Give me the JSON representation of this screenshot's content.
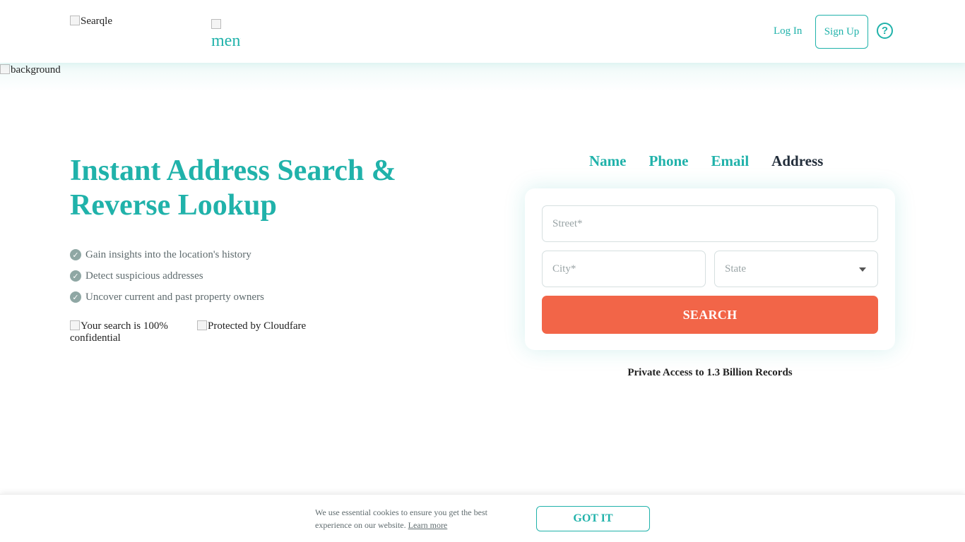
{
  "header": {
    "logo_alt": "Searqle",
    "menu_alt": "menu",
    "login_label": "Log In",
    "signup_label": "Sign Up",
    "help_symbol": "?",
    "accent_color": "#20b2aa"
  },
  "background_alt": "background",
  "hero": {
    "title_line1": "Instant Address Search &",
    "title_line2": "Reverse Lookup",
    "features": [
      "Gain insights into the location's history",
      "Detect suspicious addresses",
      "Uncover current and past property owners"
    ],
    "trust_badges": [
      "Your search is 100% confidential",
      "Protected by Cloudfare"
    ]
  },
  "search": {
    "tabs": [
      "Name",
      "Phone",
      "Email",
      "Address"
    ],
    "active_tab": "Address",
    "street_placeholder": "Street*",
    "city_placeholder": "City*",
    "state_placeholder": "State",
    "button_label": "SEARCH",
    "button_color": "#f26548",
    "records_text": "Private Access to 1.3 Billion Records"
  },
  "cookie": {
    "text": "We use essential cookies to ensure you get the best experience on our website.",
    "link_label": "Learn more",
    "button_label": "GOT IT"
  }
}
